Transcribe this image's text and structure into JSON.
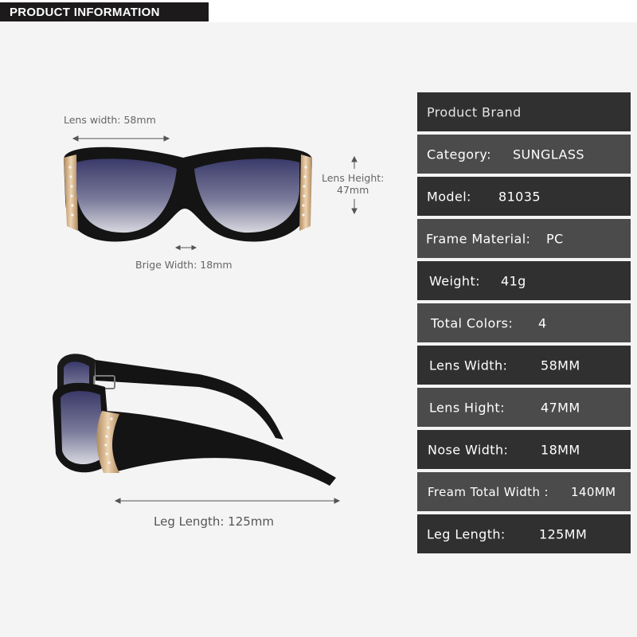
{
  "header": {
    "title": "PRODUCT INFORMATION"
  },
  "dimensions": {
    "lens_width": "Lens width:  58mm",
    "lens_height_label": "Lens Height:",
    "lens_height_value": "47mm",
    "bridge_width": "Brige Width: 18mm",
    "leg_length": "Leg Length: 125mm"
  },
  "specs": [
    {
      "label": "Product Brand",
      "value": ""
    },
    {
      "label": "Category:",
      "value": "SUNGLASS"
    },
    {
      "label": "Model:",
      "value": "81035"
    },
    {
      "label": "Frame Material:",
      "value": "PC"
    },
    {
      "label": "Weight:",
      "value": "41g"
    },
    {
      "label": "Total Colors:",
      "value": "4"
    },
    {
      "label": "Lens Width:",
      "value": "58MM"
    },
    {
      "label": "Lens Hight:",
      "value": "47MM"
    },
    {
      "label": "Nose Width:",
      "value": "18MM"
    },
    {
      "label": "Fream Total Width :",
      "value": "140MM"
    },
    {
      "label": "Leg Length:",
      "value": "125MM"
    }
  ],
  "colors": {
    "table_dark": "#303030",
    "table_light": "#4b4b4b",
    "frame": "#141414",
    "gold_accent": "#d8b48a"
  }
}
